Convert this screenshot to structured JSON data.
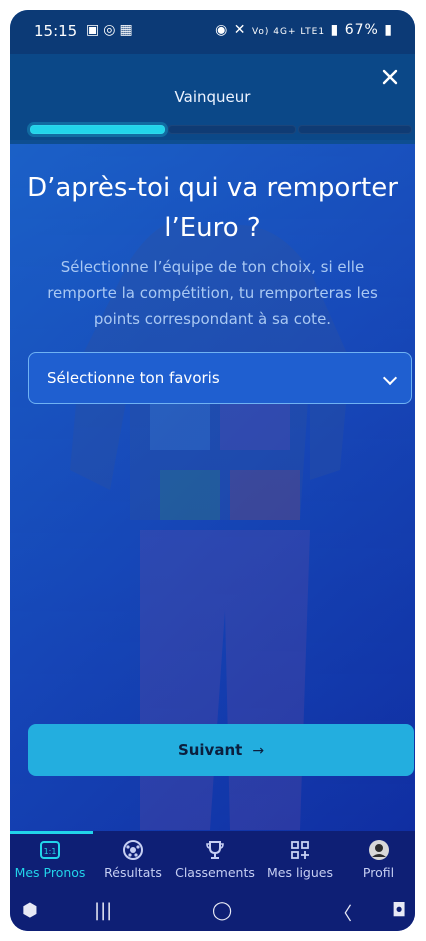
{
  "status_bar": {
    "time": "15:15",
    "left_icons": [
      "image-icon",
      "whatsapp-icon",
      "teams-icon"
    ],
    "right_text": "Vo) 4G+ LTE1",
    "battery": "67%"
  },
  "header": {
    "title": "Vainqueur",
    "close_icon": "close-icon",
    "progress": {
      "steps": 3,
      "current": 1
    }
  },
  "main": {
    "title": "D’après-toi qui va remporter l’Euro ?",
    "subtitle": "Sélectionne l’équipe de ton choix, si elle remporte la compétition, tu remporteras les points correspondant à sa cote.",
    "select": {
      "placeholder": "Sélectionne ton favoris"
    },
    "next_button": {
      "label": "Suivant",
      "arrow": "→"
    }
  },
  "bottom_nav": {
    "items": [
      {
        "label": "Mes Pronos",
        "icon": "onevsone-icon",
        "active": true
      },
      {
        "label": "Résultats",
        "icon": "soccer-ball-icon",
        "active": false
      },
      {
        "label": "Classements",
        "icon": "trophy-icon",
        "active": false
      },
      {
        "label": "Mes ligues",
        "icon": "grid-add-icon",
        "active": false
      },
      {
        "label": "Profil",
        "icon": "avatar-icon",
        "active": false
      }
    ]
  },
  "system_nav": [
    "apps-icon",
    "recents-icon",
    "home-icon",
    "back-icon",
    "assistant-icon"
  ],
  "colors": {
    "accent": "#22d4ea",
    "header": "#0b4888",
    "button": "#23aedf",
    "nav": "#0e1f75"
  }
}
